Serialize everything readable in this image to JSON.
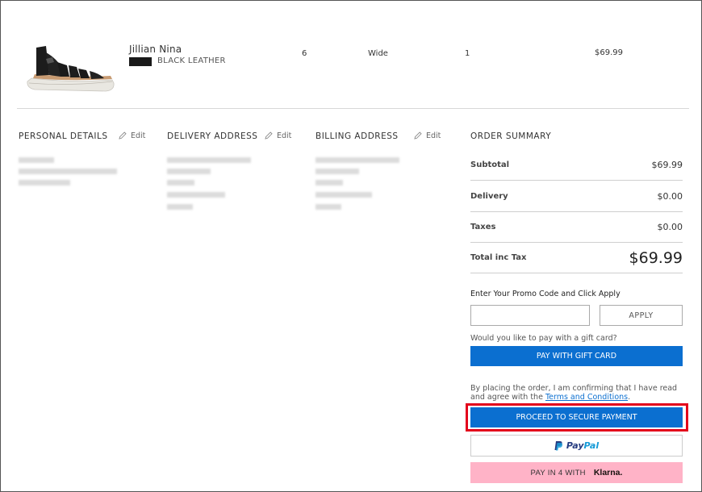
{
  "product": {
    "name": "Jillian Nina",
    "color": "BLACK LEATHER",
    "size": "6",
    "width": "Wide",
    "quantity": "1",
    "price": "$69.99"
  },
  "sections": {
    "personal": {
      "title": "PERSONAL DETAILS",
      "edit": "Edit"
    },
    "delivery": {
      "title": "DELIVERY ADDRESS",
      "edit": "Edit"
    },
    "billing": {
      "title": "BILLING ADDRESS",
      "edit": "Edit"
    }
  },
  "summary": {
    "title": "ORDER SUMMARY",
    "rows": [
      {
        "label": "Subtotal",
        "value": "$69.99"
      },
      {
        "label": "Delivery",
        "value": "$0.00"
      },
      {
        "label": "Taxes",
        "value": "$0.00"
      },
      {
        "label": "Total inc Tax",
        "value": "$69.99"
      }
    ],
    "promo_label": "Enter Your Promo Code and Click Apply",
    "promo_value": "",
    "apply_label": "APPLY",
    "gift_question": "Would you like to pay with a gift card?",
    "gift_button": "PAY WITH GIFT CARD",
    "terms_prefix": "By placing the order, I am confirming that I have read and agree with the ",
    "terms_link": "Terms and Conditions",
    "terms_suffix": ".",
    "secure_button": "PROCEED TO SECURE PAYMENT",
    "paypal_pay": "Pay",
    "paypal_pal": "Pal",
    "klarna_prefix": "PAY IN 4 WITH",
    "klarna_logo": "Klarna."
  },
  "colors": {
    "primary_blue": "#0b6fd0",
    "highlight_red": "#e3001b",
    "klarna_pink": "#ffb3c7"
  }
}
